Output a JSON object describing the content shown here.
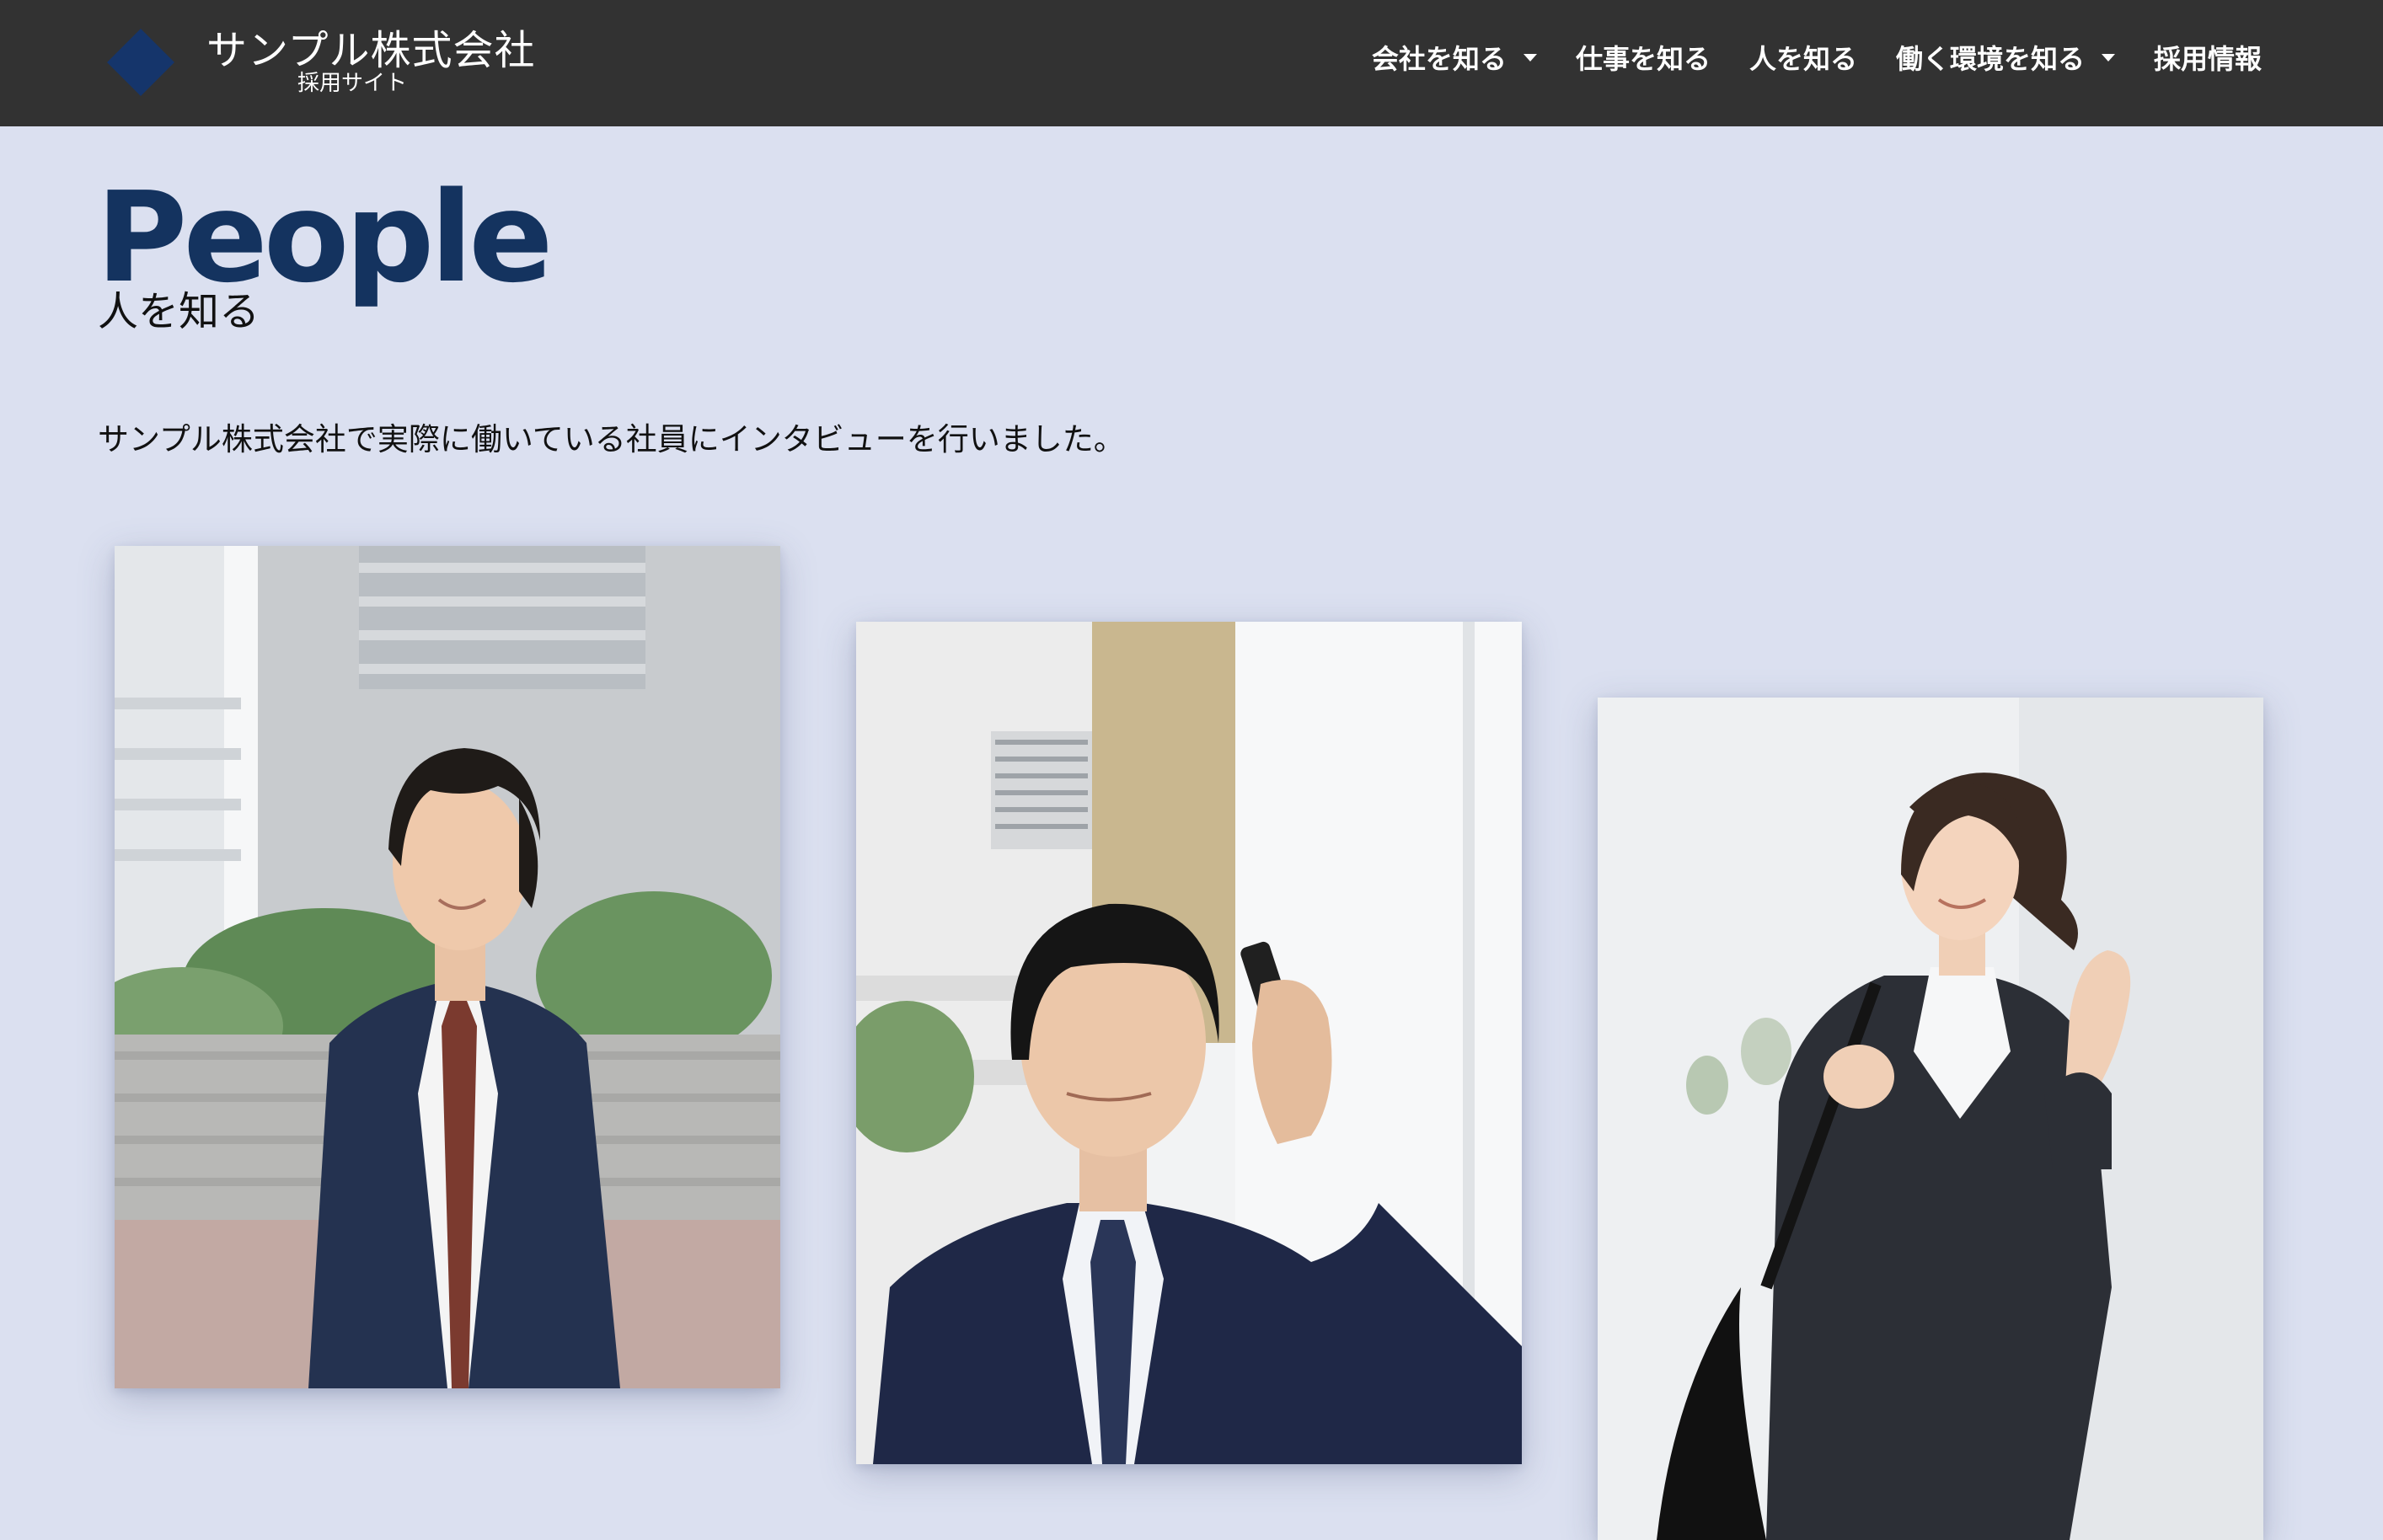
{
  "header": {
    "brand_title": "サンプル株式会社",
    "brand_subtitle": "採用サイト",
    "logo_icon": "diamond-logo-icon",
    "brand_color": "#15356b",
    "nav": [
      {
        "label": "会社を知る",
        "dropdown": true
      },
      {
        "label": "仕事を知る",
        "dropdown": false
      },
      {
        "label": "人を知る",
        "dropdown": false
      },
      {
        "label": "働く環境を知る",
        "dropdown": true
      },
      {
        "label": "採用情報",
        "dropdown": false
      }
    ]
  },
  "page": {
    "heading": "People",
    "subheading": "人を知る",
    "intro": "サンプル株式会社で実際に働いている社員にインタビューを行いました。"
  },
  "people": [
    {
      "photo": "smiling man in navy suit and brown tie, outdoors with office buildings"
    },
    {
      "photo": "man in navy suit talking on mobile phone, in front of white building"
    },
    {
      "photo": "smiling woman in dark suit holding bag strap, making fist pose"
    }
  ],
  "colors": {
    "header_bg": "#323232",
    "page_bg": "#dbe0f0",
    "heading": "#14335f"
  }
}
